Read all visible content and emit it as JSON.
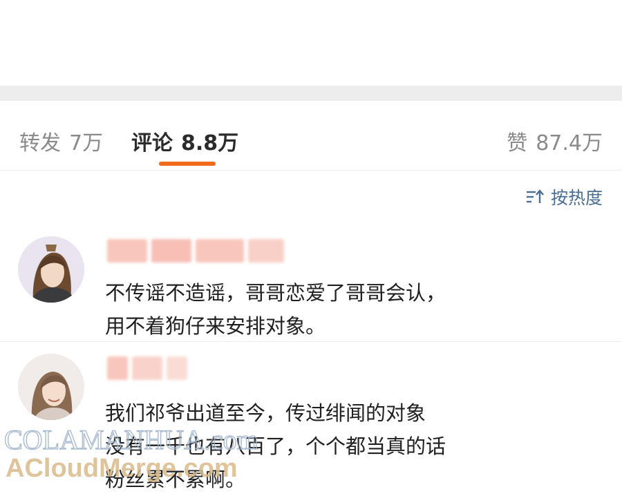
{
  "tabs": {
    "repost_label": "转发",
    "repost_count": "7万",
    "comments_label": "评论",
    "comments_count": "8.8万",
    "likes_label": "赞",
    "likes_count": "87.4万",
    "accent_color": "#f26b1d"
  },
  "sort": {
    "icon": "sort-icon",
    "label": "按热度"
  },
  "comments": [
    {
      "avatar_icon": "avatar",
      "lines": [
        "不传谣不造谣，哥哥恋爱了哥哥会认，",
        "用不着狗仔来安排对象。"
      ]
    },
    {
      "avatar_icon": "avatar",
      "lines": [
        "我们祁爷出道至今，传过绯闻的对象",
        "没有一千也有八百了，个个都当真的话",
        "粉丝累不累啊。"
      ]
    }
  ],
  "watermark": {
    "line1": "COLAMANHUA.com",
    "line2": "ACloudMerge.com"
  }
}
